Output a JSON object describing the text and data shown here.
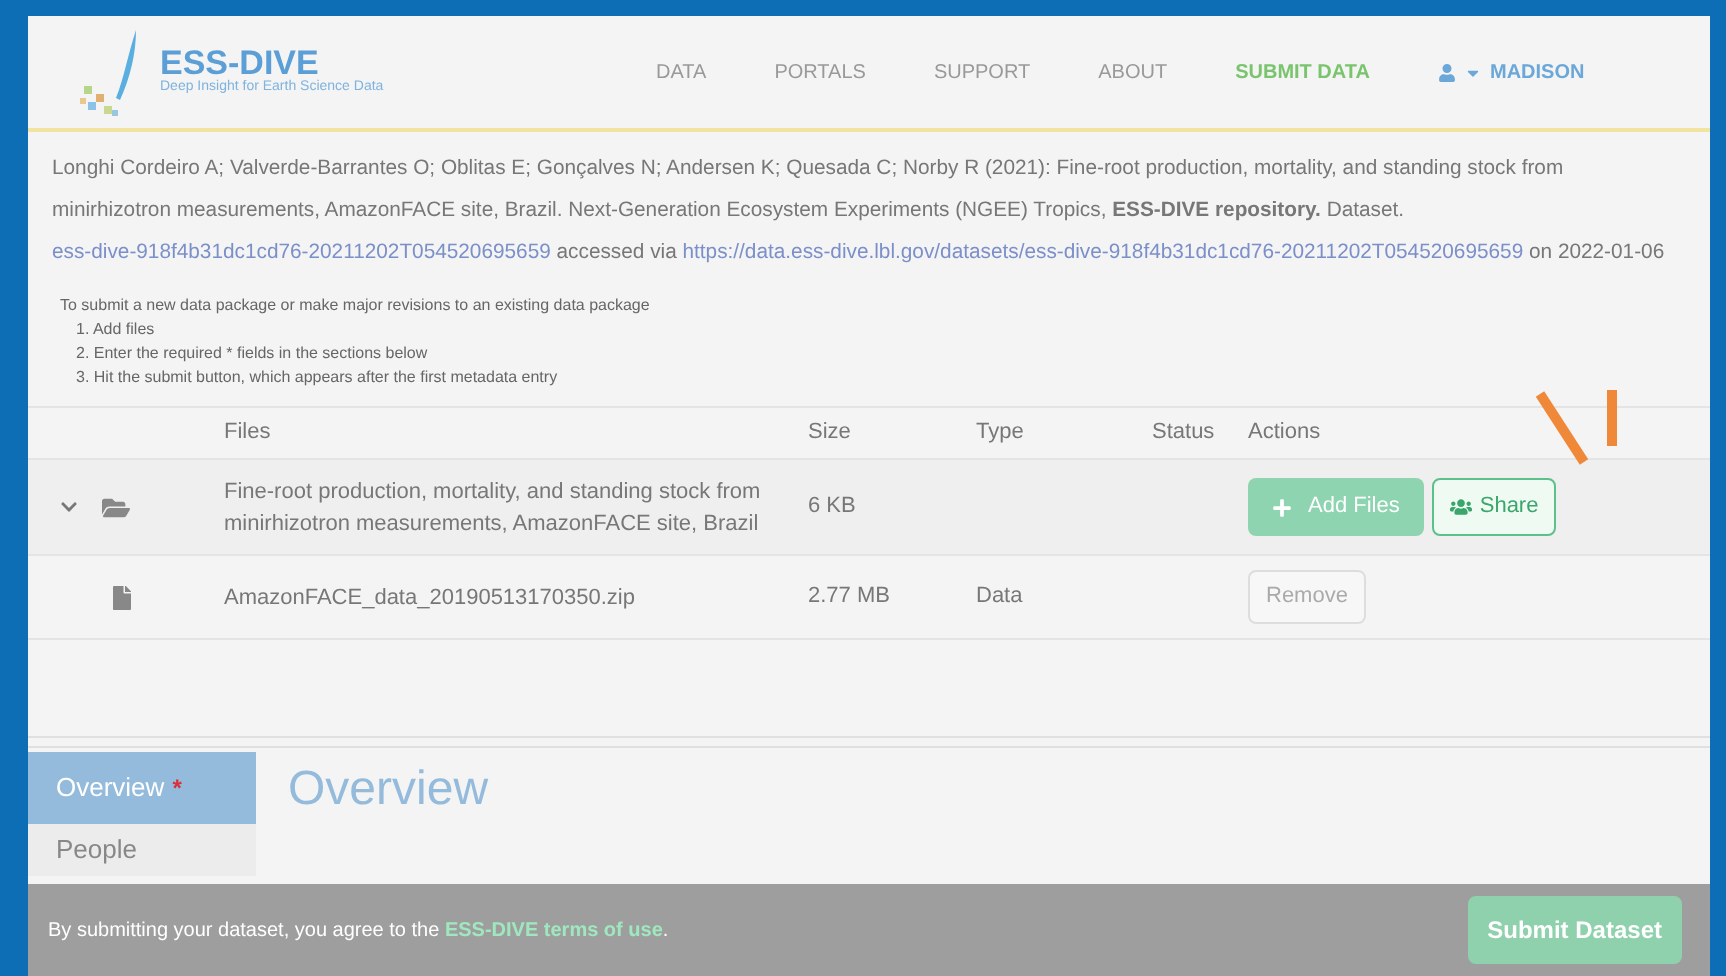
{
  "logo": {
    "title": "ESS-DIVE",
    "tagline": "Deep Insight for Earth Science Data"
  },
  "nav": [
    {
      "label": "DATA",
      "selected": false
    },
    {
      "label": "PORTALS",
      "selected": false
    },
    {
      "label": "SUPPORT",
      "selected": false
    },
    {
      "label": "ABOUT",
      "selected": false
    },
    {
      "label": "SUBMIT DATA",
      "selected": true
    }
  ],
  "user": {
    "name": "MADISON"
  },
  "citation": {
    "text": "Longhi Cordeiro A; Valverde-Barrantes O; Oblitas E; Gonçalves N; Andersen K; Quesada C; Norby R (2021): Fine-root production, mortality, and standing stock from minirhizotron measurements, AmazonFACE site, Brazil. Next-Generation Ecosystem Experiments (NGEE) Tropics, **ESS-DIVE repository.** Dataset.",
    "doi": "ess-dive-918f4b31dc1cd76-20211202T054520695659",
    "accessed": "accessed via",
    "url": "https://data.ess-dive.lbl.gov/datasets/ess-dive-918f4b31dc1cd76-20211202T054520695659",
    "date": "on 2022-01-06"
  },
  "instructions": {
    "intro": "To submit a new data package or make major revisions to an existing data package",
    "steps": [
      "1. Add files",
      "2. Enter the required * fields in the sections below",
      "3. Hit the submit button, which appears after the first metadata entry"
    ]
  },
  "table": {
    "columns": [
      "Files",
      "Size",
      "Type",
      "Status",
      "Actions"
    ],
    "rows": [
      {
        "kind": "folder",
        "expanded": true,
        "name": "Fine-root production, mortality, and standing stock from minirhizotron measurements, AmazonFACE site, Brazil",
        "size": "6 KB",
        "type": "",
        "actions": [
          "Add Files",
          "Share"
        ]
      },
      {
        "kind": "file",
        "name": "AmazonFACE_data_20190513170350.zip",
        "size": "2.77 MB",
        "type": "Data",
        "actions": [
          "Remove"
        ]
      }
    ]
  },
  "sections": [
    {
      "label": "Overview",
      "required": "*",
      "selected": true
    },
    {
      "label": "People",
      "selected": false
    }
  ],
  "section_title": "Overview",
  "footer": {
    "text": "By submitting your dataset, you agree to the",
    "link": "ESS-DIVE terms of use",
    "end": ".",
    "button": "Submit Dataset"
  }
}
